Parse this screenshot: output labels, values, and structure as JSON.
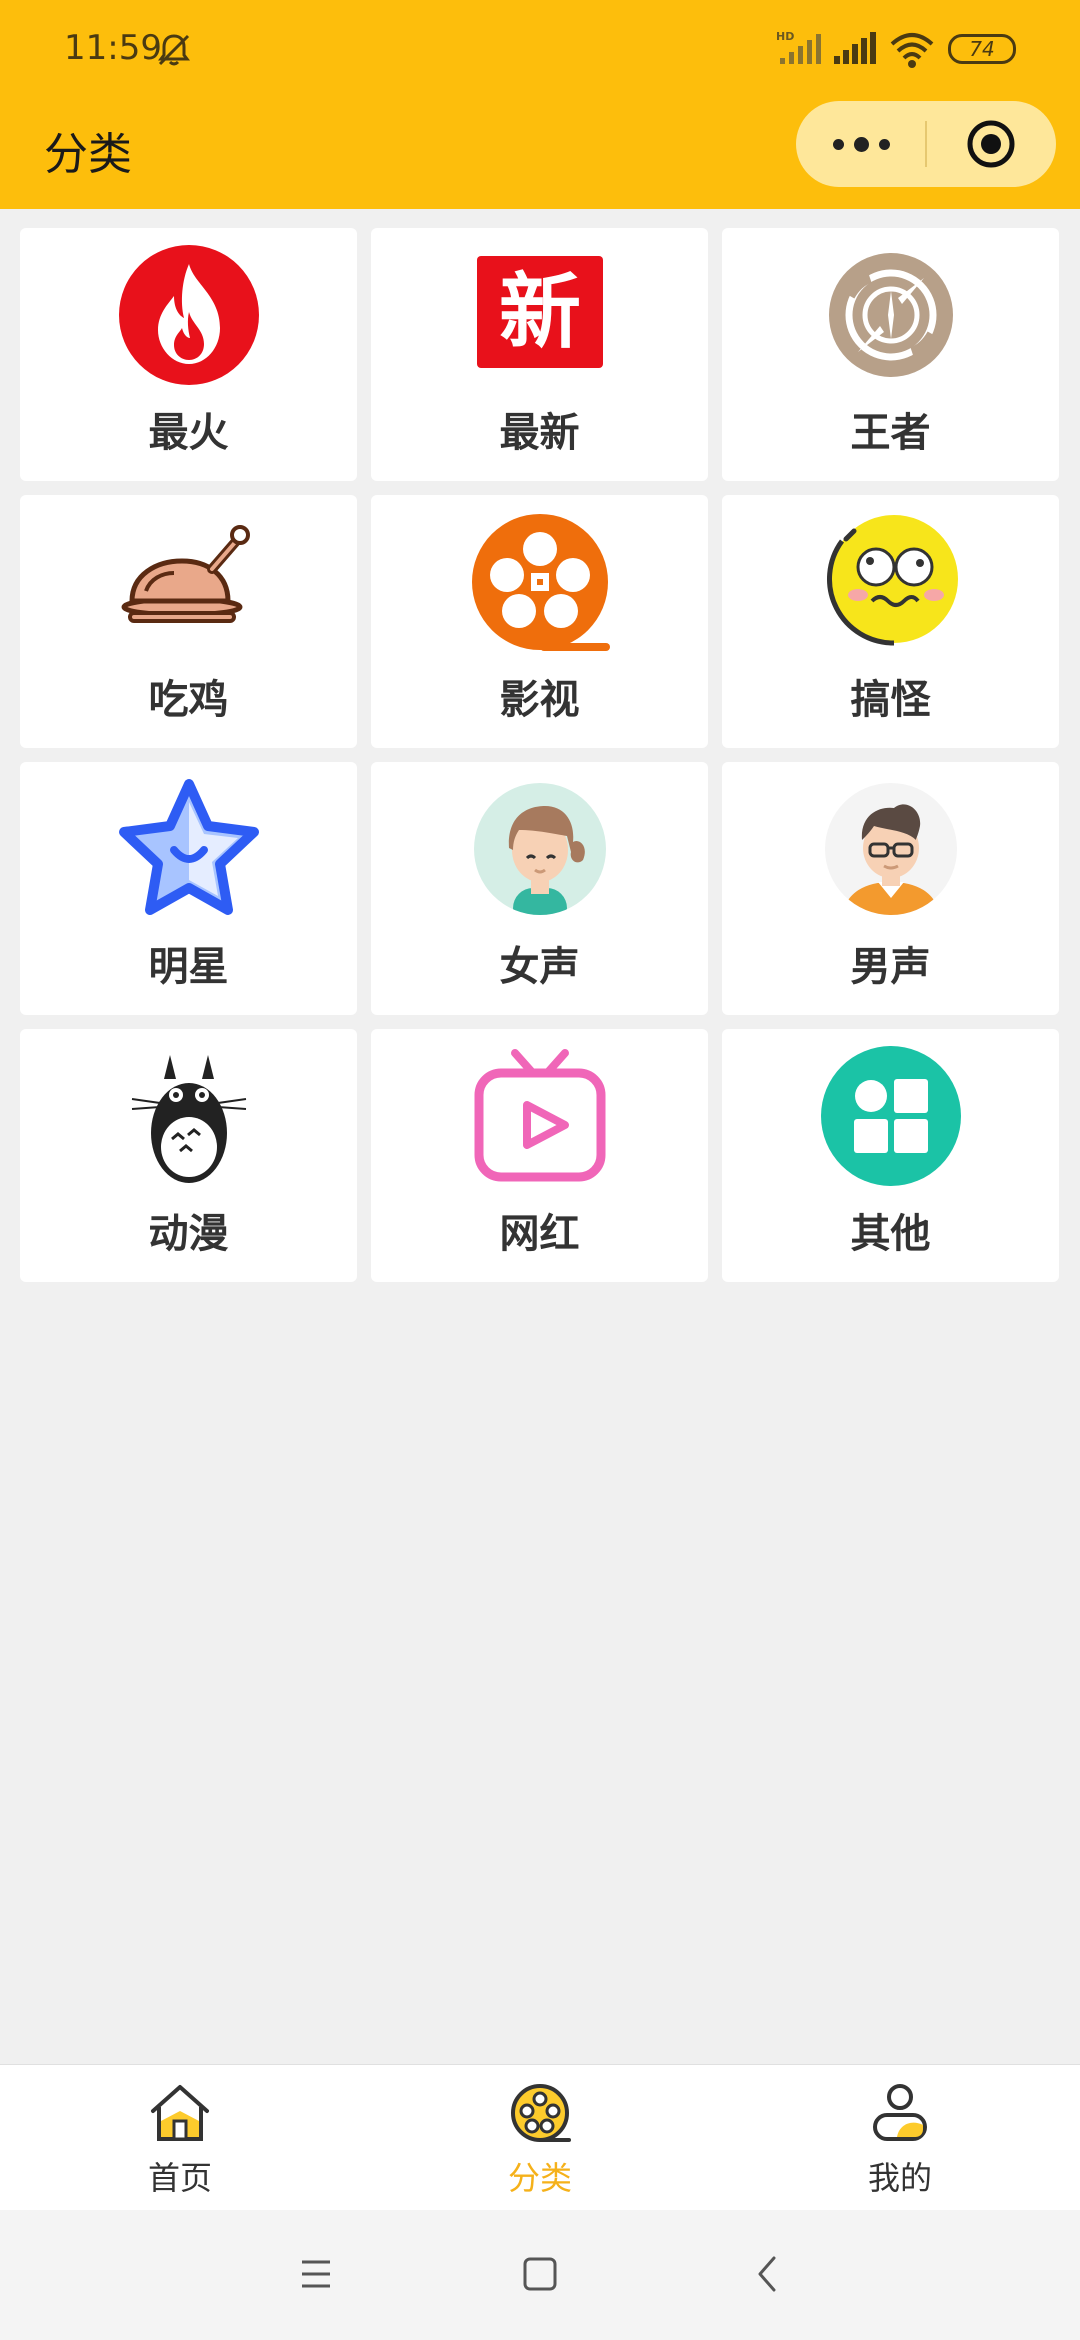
{
  "status_bar": {
    "time": "11:59",
    "battery": "74"
  },
  "header": {
    "title": "分类",
    "bg_color": "#FDBE0C",
    "capsule_icons": [
      "more-icon",
      "target-icon"
    ]
  },
  "categories": [
    {
      "label": "最火",
      "icon": "fire-icon"
    },
    {
      "label": "最新",
      "icon": "new-icon",
      "icon_text": "新"
    },
    {
      "label": "王者",
      "icon": "king-icon"
    },
    {
      "label": "吃鸡",
      "icon": "roast-chicken-icon"
    },
    {
      "label": "影视",
      "icon": "film-reel-icon"
    },
    {
      "label": "搞怪",
      "icon": "funny-face-icon"
    },
    {
      "label": "明星",
      "icon": "star-icon"
    },
    {
      "label": "女声",
      "icon": "female-avatar-icon"
    },
    {
      "label": "男声",
      "icon": "male-avatar-icon"
    },
    {
      "label": "动漫",
      "icon": "totoro-icon"
    },
    {
      "label": "网红",
      "icon": "tv-play-icon"
    },
    {
      "label": "其他",
      "icon": "grid-icon"
    }
  ],
  "tabbar": {
    "items": [
      {
        "label": "首页",
        "icon": "home-icon"
      },
      {
        "label": "分类",
        "icon": "category-reel-icon",
        "active": true
      },
      {
        "label": "我的",
        "icon": "user-icon"
      }
    ],
    "active_color": "#F5B11A"
  },
  "navbar": {
    "icons": [
      "menu-icon",
      "home-square-icon",
      "back-icon"
    ]
  }
}
